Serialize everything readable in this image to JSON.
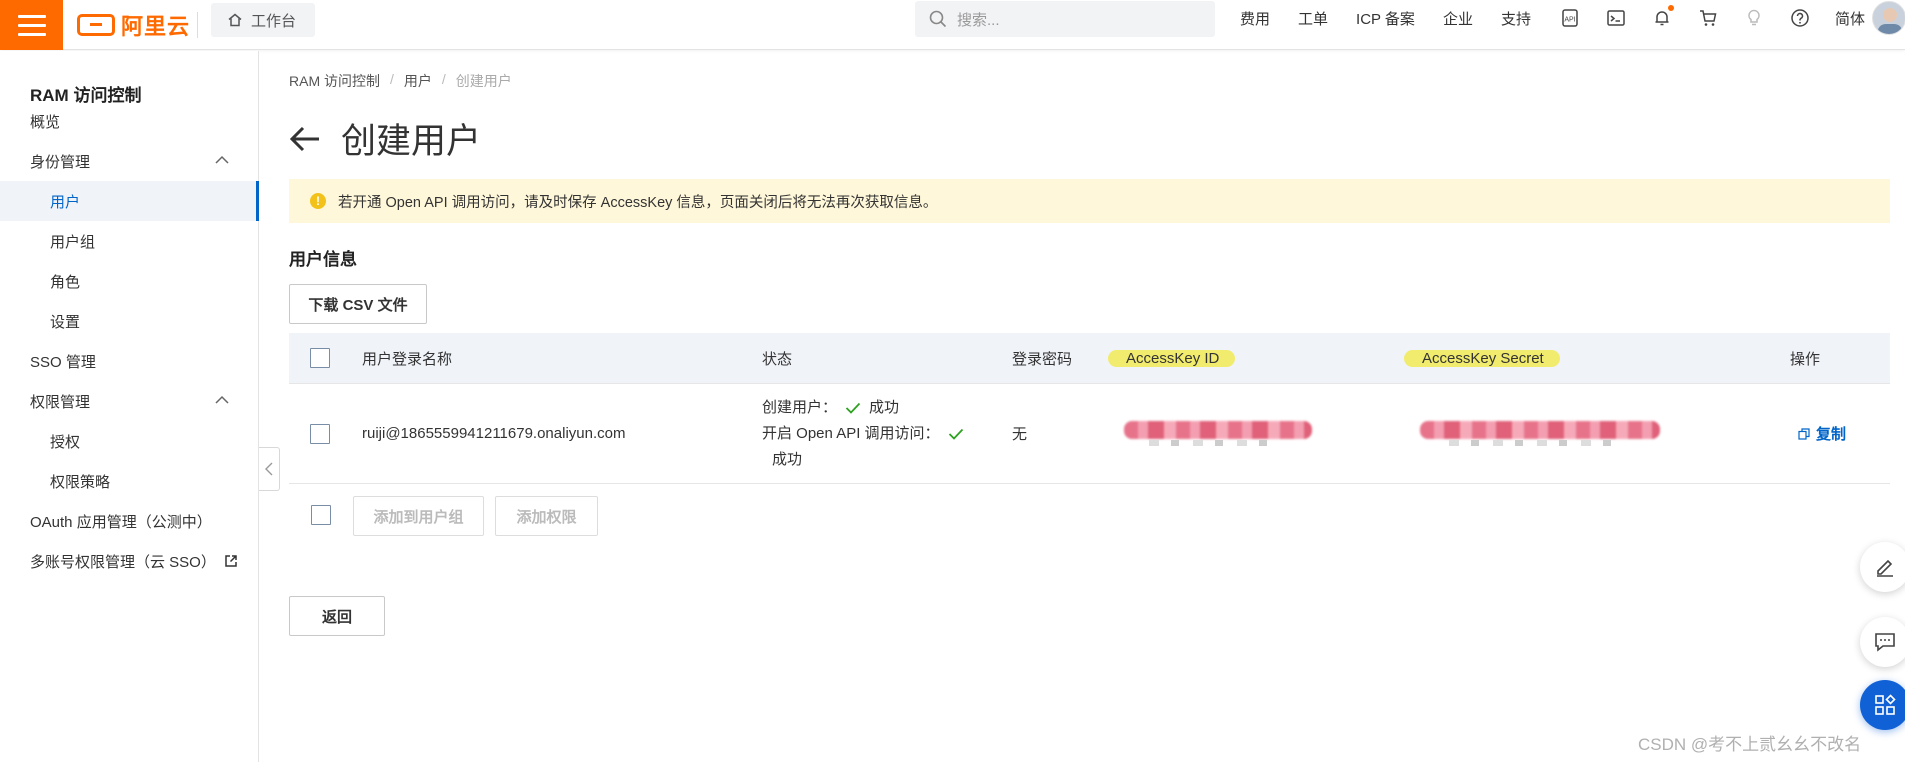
{
  "topbar": {
    "logo_text": "阿里云",
    "workbench_label": "工作台",
    "search_placeholder": "搜索...",
    "nav_items": [
      "费用",
      "工单",
      "ICP 备案",
      "企业",
      "支持"
    ],
    "lang_label": "简体",
    "icons": [
      "api-icon",
      "terminal-icon",
      "bell-icon",
      "cart-icon",
      "lightbulb-icon",
      "help-icon"
    ],
    "accent_color": "#ff6a00"
  },
  "sidebar": {
    "title": "RAM 访问控制",
    "items": [
      {
        "label": "概览"
      },
      {
        "label": "身份管理"
      },
      {
        "label": "用户"
      },
      {
        "label": "用户组"
      },
      {
        "label": "角色"
      },
      {
        "label": "设置"
      },
      {
        "label": "SSO 管理"
      },
      {
        "label": "权限管理"
      },
      {
        "label": "授权"
      },
      {
        "label": "权限策略"
      },
      {
        "label": "OAuth 应用管理（公测中）"
      },
      {
        "label": "多账号权限管理（云 SSO）"
      }
    ],
    "active_color": "#0064c8"
  },
  "breadcrumb": {
    "items": [
      "RAM 访问控制",
      "用户",
      "创建用户"
    ]
  },
  "page": {
    "title": "创建用户",
    "alert_text": "若开通 Open API 调用访问，请及时保存 AccessKey 信息，页面关闭后将无法再次获取信息。",
    "section_title": "用户信息",
    "download_button": "下载 CSV 文件",
    "back_button": "返回"
  },
  "table": {
    "headers": [
      "用户登录名称",
      "状态",
      "登录密码",
      "AccessKey ID",
      "AccessKey Secret",
      "操作"
    ],
    "rows": [
      {
        "login_name": "ruiji@1865559941211679.onaliyun.com",
        "status_create_label": "创建用户：",
        "status_create_value": "成功",
        "status_api_label": "开启 Open API 调用访问：",
        "status_api_value": "成功",
        "password": "无",
        "action": "复制"
      }
    ],
    "footer_buttons": [
      "添加到用户组",
      "添加权限"
    ]
  },
  "watermark": "CSDN @考不上贰幺幺不改名"
}
